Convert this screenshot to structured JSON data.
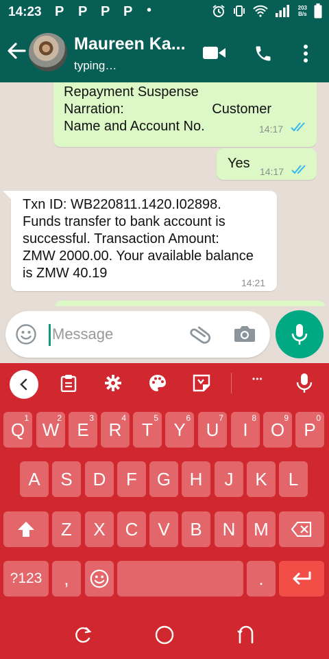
{
  "status_bar": {
    "time": "14:23",
    "notifications": [
      "P",
      "P",
      "P",
      "P"
    ],
    "dot": "•",
    "net_speed_value": "203",
    "net_speed_unit": "B/s",
    "icons": [
      "alarm-icon",
      "vibrate-icon",
      "wifi-icon",
      "signal-icon",
      "battery-icon"
    ]
  },
  "header": {
    "contact_name": "Maureen Ka...",
    "status": "typing…",
    "icons": [
      "back-arrow-icon",
      "video-call-icon",
      "voice-call-icon",
      "more-vert-icon"
    ]
  },
  "messages": [
    {
      "direction": "outgoing",
      "line1": "Repayment Suspense",
      "line2_left": "Narration:",
      "line2_right": "Customer",
      "line3": "Name and Account No.",
      "time": "14:17",
      "status": "read"
    },
    {
      "direction": "outgoing",
      "text": "Yes",
      "time": "14:17",
      "status": "read"
    },
    {
      "direction": "incoming",
      "lines": [
        "Txn ID: WB220811.1420.I02898.",
        "Funds transfer to bank account is",
        "successful. Transaction Amount:",
        "ZMW 2000.00. Your available balance",
        "is ZMW 40.19"
      ],
      "time": "14:21"
    }
  ],
  "composer": {
    "placeholder": "Message"
  },
  "keyboard": {
    "row1": [
      {
        "label": "Q",
        "hint": "1"
      },
      {
        "label": "W",
        "hint": "2"
      },
      {
        "label": "E",
        "hint": "3"
      },
      {
        "label": "R",
        "hint": "4"
      },
      {
        "label": "T",
        "hint": "5"
      },
      {
        "label": "Y",
        "hint": "6"
      },
      {
        "label": "U",
        "hint": "7"
      },
      {
        "label": "I",
        "hint": "8"
      },
      {
        "label": "O",
        "hint": "9"
      },
      {
        "label": "P",
        "hint": "0"
      }
    ],
    "row2": [
      "A",
      "S",
      "D",
      "F",
      "G",
      "H",
      "J",
      "K",
      "L"
    ],
    "row3": [
      "Z",
      "X",
      "C",
      "V",
      "B",
      "N",
      "M"
    ],
    "symbols_key": "?123",
    "comma_key": ",",
    "period_key": ".",
    "toolbar_dots": "•••",
    "colors": {
      "background": "#d0282e",
      "key": "#e3666a",
      "enter": "#f04e47"
    }
  },
  "colors": {
    "header": "#075e54",
    "outgoing_bubble": "#dcf8c6",
    "incoming_bubble": "#ffffff",
    "mic": "#00a884",
    "read_ticks": "#34b7f1"
  }
}
